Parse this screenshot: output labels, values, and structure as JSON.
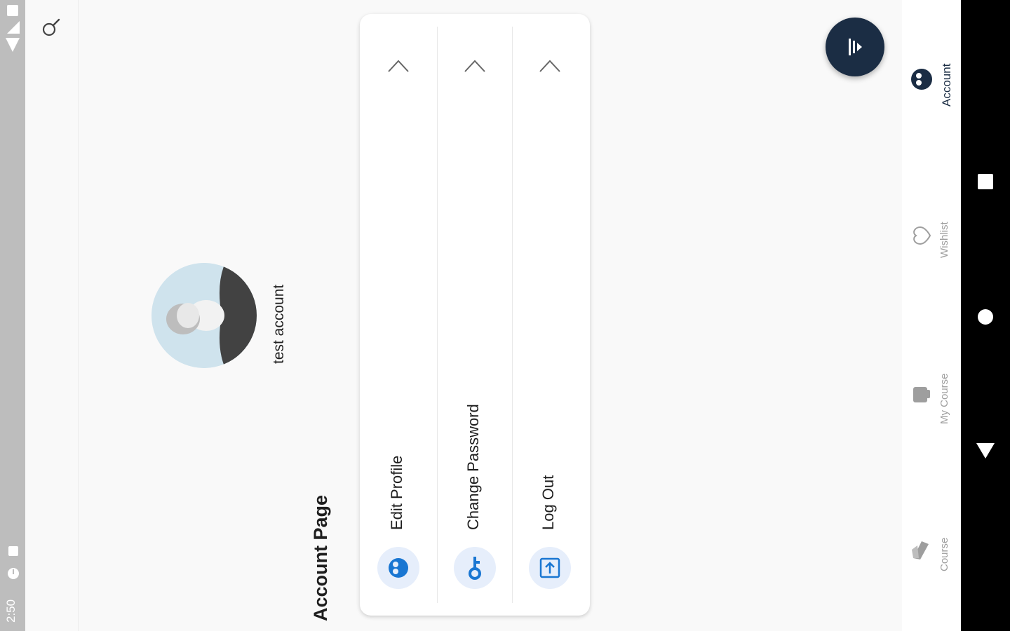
{
  "status_bar": {
    "time": "2:50"
  },
  "page": {
    "title": "Account Page"
  },
  "profile": {
    "name": "test account"
  },
  "menu": {
    "items": [
      {
        "label": "Edit Profile",
        "icon": "account-circle-icon"
      },
      {
        "label": "Change Password",
        "icon": "key-icon"
      },
      {
        "label": "Log Out",
        "icon": "logout-icon"
      }
    ]
  },
  "bottom_nav": {
    "items": [
      {
        "label": "Account",
        "icon": "account-icon",
        "active": true
      },
      {
        "label": "Wishlist",
        "icon": "heart-icon",
        "active": false
      },
      {
        "label": "My Course",
        "icon": "course-bag-icon",
        "active": false
      },
      {
        "label": "Course",
        "icon": "books-icon",
        "active": false
      }
    ]
  },
  "colors": {
    "primary": "#1b2d44",
    "accent_blue": "#1976d2",
    "icon_bg": "#e6eefb",
    "background": "#f9f9f9"
  }
}
